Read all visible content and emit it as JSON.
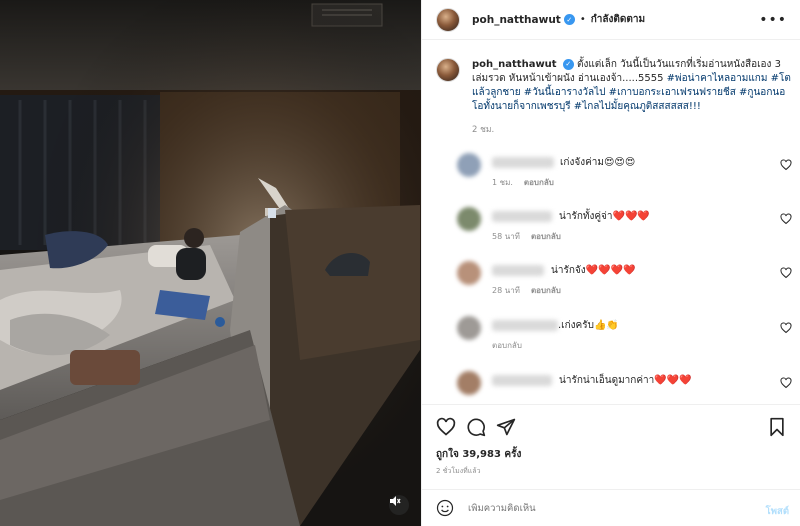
{
  "post": {
    "username": "poh_natthawut",
    "follow_label": "กำลังติดตาม",
    "more_label": "•••",
    "caption_text": "ตั้งแต่เล็ก วันนี้เป็นวันแรกที่เริ่มอ่านหนังสือเอง 3 เล่มรวด หันหน้าเข้าผนัง อ่านเองจ้า.....5555 ",
    "caption_tags": "#พ่อน่าคาไหลอามแกม #โตแล้วลูกชาย #วันนี้เอารางวัลไป #เกาบอกระเอาเฟรนฟรายชีส #กูนอกนอโอทั้งนายก็จากเพชรบุรี #ไกลไปมั้ยคุณภูติสสสสสส!!!",
    "caption_time": "2 ชม.",
    "likes_label": "ถูกใจ",
    "likes_count": "39,983",
    "likes_suffix": "ครั้ง",
    "date_text": "2 ชั่วโมงที่แล้ว"
  },
  "media": {
    "mute_icon": "speaker-muted-icon"
  },
  "comments": [
    {
      "text": "เก่งจังค่าม😍😍😍",
      "time": "1 ชม.",
      "reply": "ตอบกลับ"
    },
    {
      "text": "น่ารักทั้งคู่จ่า❤️❤️❤️",
      "time": "58 นาที",
      "reply": "ตอบกลับ"
    },
    {
      "text": "น่ารักจัง❤️❤️❤️❤️",
      "time": "28 นาที",
      "reply": "ตอบกลับ"
    },
    {
      "text": ".เก่งครับ👍👏",
      "time": "",
      "reply": "ตอบกลับ"
    },
    {
      "text": "น่ารักน่าเอ็นดูมากค่าา❤️❤️❤️",
      "time": "",
      "reply": ""
    }
  ],
  "composer": {
    "placeholder": "เพิ่มความคิดเห็น",
    "post_label": "โพสต์"
  },
  "colors": {
    "link": "#00376b",
    "verified": "#3897f0",
    "muted": "#8e8e8e",
    "border": "#efefef"
  }
}
